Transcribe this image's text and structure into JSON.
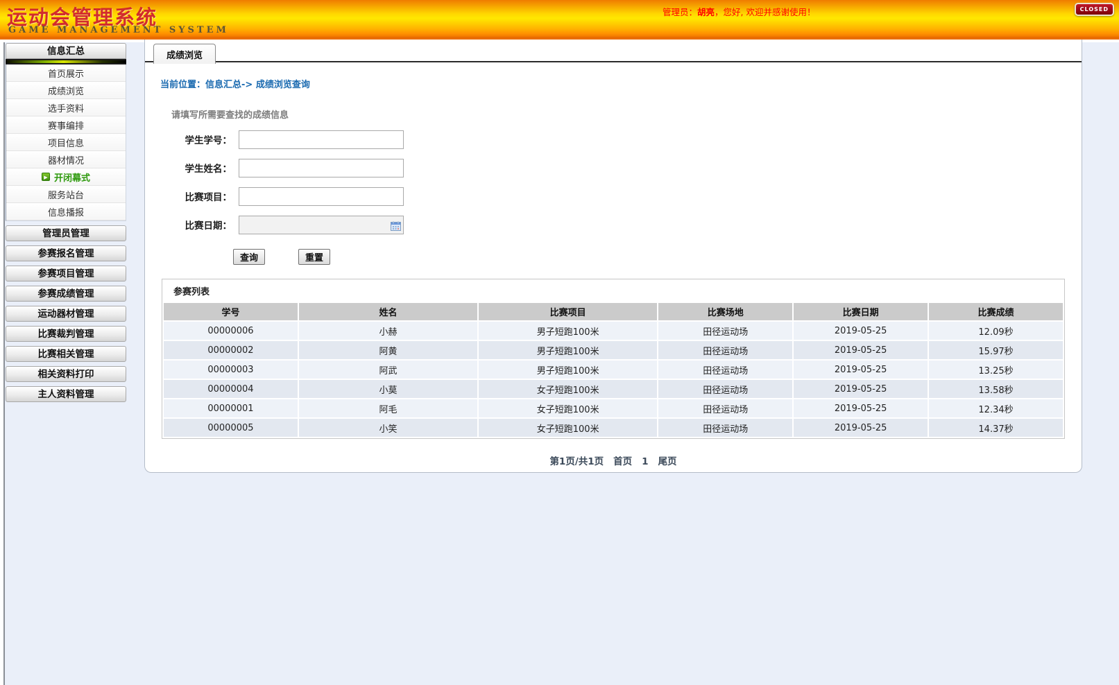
{
  "header": {
    "title": "运动会管理系统",
    "subtitle": "GAME MANAGEMENT SYSTEM",
    "admin_prefix": "管理员：",
    "admin_name": "胡亮",
    "admin_suffix": "，您好, 欢迎并感谢使用！",
    "close_button": "CLOSED"
  },
  "sidebar": {
    "section_title": "信息汇总",
    "items": [
      {
        "label": "首页展示",
        "active": false
      },
      {
        "label": "成绩浏览",
        "active": false
      },
      {
        "label": "选手资料",
        "active": false
      },
      {
        "label": "赛事编排",
        "active": false
      },
      {
        "label": "项目信息",
        "active": false
      },
      {
        "label": "器材情况",
        "active": false
      },
      {
        "label": "开闭幕式",
        "active": true
      },
      {
        "label": "服务站台",
        "active": false
      },
      {
        "label": "信息播报",
        "active": false
      }
    ],
    "sections": [
      "管理员管理",
      "参赛报名管理",
      "参赛项目管理",
      "参赛成绩管理",
      "运动器材管理",
      "比赛裁判管理",
      "比赛相关管理",
      "相关资料打印",
      "主人资料管理"
    ]
  },
  "main": {
    "tab": "成绩浏览",
    "breadcrumb": "当前位置：信息汇总-> 成绩浏览查询",
    "form": {
      "title": "请填写所需要查找的成绩信息",
      "fields": [
        {
          "label": "学生学号：",
          "value": "",
          "type": "text"
        },
        {
          "label": "学生姓名：",
          "value": "",
          "type": "text"
        },
        {
          "label": "比赛项目：",
          "value": "",
          "type": "text"
        },
        {
          "label": "比赛日期：",
          "value": "",
          "type": "date"
        }
      ],
      "query_button": "查询",
      "reset_button": "重置"
    },
    "table": {
      "title": "参赛列表",
      "headers": [
        "学号",
        "姓名",
        "比赛项目",
        "比赛场地",
        "比赛日期",
        "比赛成绩"
      ],
      "rows": [
        [
          "00000006",
          "小赫",
          "男子短跑100米",
          "田径运动场",
          "2019-05-25",
          "12.09秒"
        ],
        [
          "00000002",
          "阿黄",
          "男子短跑100米",
          "田径运动场",
          "2019-05-25",
          "15.97秒"
        ],
        [
          "00000003",
          "阿武",
          "男子短跑100米",
          "田径运动场",
          "2019-05-25",
          "13.25秒"
        ],
        [
          "00000004",
          "小莫",
          "女子短跑100米",
          "田径运动场",
          "2019-05-25",
          "13.58秒"
        ],
        [
          "00000001",
          "阿毛",
          "女子短跑100米",
          "田径运动场",
          "2019-05-25",
          "12.34秒"
        ],
        [
          "00000005",
          "小笑",
          "女子短跑100米",
          "田径运动场",
          "2019-05-25",
          "14.37秒"
        ]
      ]
    },
    "pagination": {
      "status": "第1页/共1页",
      "first": "首页",
      "current": "1",
      "last": "尾页"
    }
  },
  "colors": {
    "header_orange_top": "#ef7c00",
    "header_yellow_mid": "#ffe800",
    "header_border": "#e96d00",
    "logo_red": "#d22c2c",
    "admin_red": "#ff0000",
    "closed_bg": "#8a0010",
    "active_green": "#2f9a0e",
    "breadcrumb_blue": "#1a6ab0",
    "page_bg": "#eaeff9",
    "table_header_bg": "#cbcbcb",
    "row_odd": "#eef2f8",
    "row_even": "#e3e8f0"
  }
}
